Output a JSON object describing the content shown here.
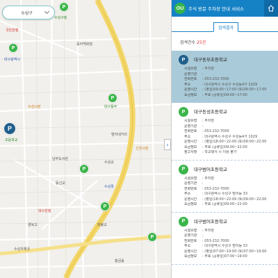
{
  "map": {
    "search_value": "수성구",
    "labels": [
      {
        "text": "국민은행",
        "cls": "red"
      },
      {
        "text": "대구광역시",
        "cls": "blue"
      },
      {
        "text": "수성구청",
        "cls": "green"
      },
      {
        "text": "동아백화점",
        "cls": ""
      },
      {
        "text": "수성시장",
        "cls": "orange"
      },
      {
        "text": "대구동부",
        "cls": "green"
      },
      {
        "text": "초등학교",
        "cls": "green"
      },
      {
        "text": "범어네거리",
        "cls": ""
      },
      {
        "text": "남부도서관",
        "cls": ""
      },
      {
        "text": "수성교",
        "cls": ""
      },
      {
        "text": "신천시장",
        "cls": "orange"
      },
      {
        "text": "동신교",
        "cls": ""
      },
      {
        "text": "수성못",
        "cls": "blue"
      },
      {
        "text": "대구은행",
        "cls": "red"
      },
      {
        "text": "경북고",
        "cls": ""
      },
      {
        "text": "대봉교",
        "cls": ""
      },
      {
        "text": "수성우체국",
        "cls": ""
      },
      {
        "text": "황금동",
        "cls": ""
      }
    ],
    "pin_label": "P",
    "collapse_label": "›"
  },
  "panel": {
    "logo_text": "OU",
    "title": "주식 방문 주차장 안내 서비스",
    "tab_label": "검색결과",
    "count_prefix": "검색건수",
    "count_value": "25",
    "count_suffix": "건",
    "pin_label": "P",
    "items": [
      {
        "name": "대구동부초등학교",
        "selected": true,
        "rows": [
          {
            "k": "시설유형",
            "v": ": 주차장"
          },
          {
            "k": "운영기관",
            "v": ": "
          },
          {
            "k": "전화번호",
            "v": ": 053-232-7000"
          },
          {
            "k": "주소",
            "v": ": 대구광역시 수성구 수성동4가 1029"
          },
          {
            "k": "운영시간",
            "v": ": (평일)09:00~17:00 (토)09:00~17:00"
          },
          {
            "k": "요금정보",
            "v": ": 무료 (공휴일)09:00~17:00"
          }
        ]
      },
      {
        "name": "대구동성초등학교",
        "selected": false,
        "rows": [
          {
            "k": "시설유형",
            "v": ": 주차장"
          },
          {
            "k": "운영기관",
            "v": ": "
          },
          {
            "k": "전화번호",
            "v": ": 053-232-7000"
          },
          {
            "k": "주소",
            "v": ": 대구광역시 수성구 수성동4가 1029"
          },
          {
            "k": "운영시간",
            "v": ": (평일)18:00~22:00 (토)09:00~22:00"
          },
          {
            "k": "요금정보",
            "v": ": 무료 (공휴일)09:00~22:00"
          },
          {
            "k": "참고사항",
            "v": ": 학교행사 시 이용 불가"
          }
        ]
      },
      {
        "name": "대구범어초등학교",
        "selected": false,
        "rows": [
          {
            "k": "시설유형",
            "v": ": 주차장"
          },
          {
            "k": "운영기관",
            "v": ": "
          },
          {
            "k": "전화번호",
            "v": ": 053-232-7000"
          },
          {
            "k": "주소",
            "v": ": 대구광역시 수성구 범어동 33"
          },
          {
            "k": "운영시간",
            "v": ": (평일)18:00~22:00 (토)09:00~22:00"
          },
          {
            "k": "요금정보",
            "v": ": 무료 (공휴일)09:00~22:00"
          }
        ]
      },
      {
        "name": "대구범어초등학교",
        "selected": false,
        "rows": [
          {
            "k": "시설유형",
            "v": ": 주차장"
          },
          {
            "k": "운영기관",
            "v": ": "
          },
          {
            "k": "전화번호",
            "v": ": 053-232-7000"
          },
          {
            "k": "주소",
            "v": ": 대구광역시 수성구 범어동 33"
          },
          {
            "k": "운영시간",
            "v": ": (평일)07:00~19:00 (토)07:00~19:00"
          },
          {
            "k": "요금정보",
            "v": ": 무료 (공휴일)07:00~19:00"
          }
        ]
      }
    ]
  }
}
